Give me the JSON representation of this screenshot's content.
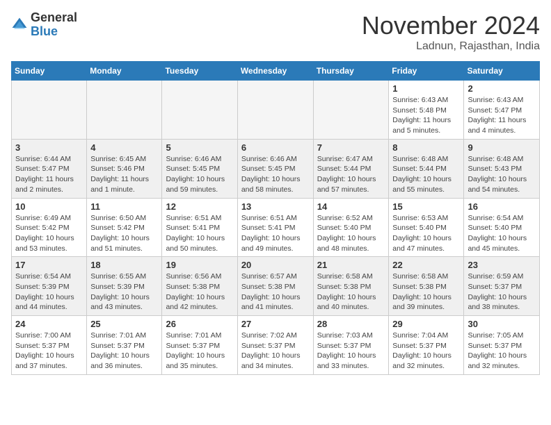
{
  "header": {
    "logo_line1": "General",
    "logo_line2": "Blue",
    "month": "November 2024",
    "location": "Ladnun, Rajasthan, India"
  },
  "days_of_week": [
    "Sunday",
    "Monday",
    "Tuesday",
    "Wednesday",
    "Thursday",
    "Friday",
    "Saturday"
  ],
  "weeks": [
    [
      {
        "day": "",
        "empty": true
      },
      {
        "day": "",
        "empty": true
      },
      {
        "day": "",
        "empty": true
      },
      {
        "day": "",
        "empty": true
      },
      {
        "day": "",
        "empty": true
      },
      {
        "day": "1",
        "sunrise": "6:43 AM",
        "sunset": "5:48 PM",
        "daylight": "11 hours and 5 minutes."
      },
      {
        "day": "2",
        "sunrise": "6:43 AM",
        "sunset": "5:47 PM",
        "daylight": "11 hours and 4 minutes."
      }
    ],
    [
      {
        "day": "3",
        "sunrise": "6:44 AM",
        "sunset": "5:47 PM",
        "daylight": "11 hours and 2 minutes."
      },
      {
        "day": "4",
        "sunrise": "6:45 AM",
        "sunset": "5:46 PM",
        "daylight": "11 hours and 1 minute."
      },
      {
        "day": "5",
        "sunrise": "6:46 AM",
        "sunset": "5:45 PM",
        "daylight": "10 hours and 59 minutes."
      },
      {
        "day": "6",
        "sunrise": "6:46 AM",
        "sunset": "5:45 PM",
        "daylight": "10 hours and 58 minutes."
      },
      {
        "day": "7",
        "sunrise": "6:47 AM",
        "sunset": "5:44 PM",
        "daylight": "10 hours and 57 minutes."
      },
      {
        "day": "8",
        "sunrise": "6:48 AM",
        "sunset": "5:44 PM",
        "daylight": "10 hours and 55 minutes."
      },
      {
        "day": "9",
        "sunrise": "6:48 AM",
        "sunset": "5:43 PM",
        "daylight": "10 hours and 54 minutes."
      }
    ],
    [
      {
        "day": "10",
        "sunrise": "6:49 AM",
        "sunset": "5:42 PM",
        "daylight": "10 hours and 53 minutes."
      },
      {
        "day": "11",
        "sunrise": "6:50 AM",
        "sunset": "5:42 PM",
        "daylight": "10 hours and 51 minutes."
      },
      {
        "day": "12",
        "sunrise": "6:51 AM",
        "sunset": "5:41 PM",
        "daylight": "10 hours and 50 minutes."
      },
      {
        "day": "13",
        "sunrise": "6:51 AM",
        "sunset": "5:41 PM",
        "daylight": "10 hours and 49 minutes."
      },
      {
        "day": "14",
        "sunrise": "6:52 AM",
        "sunset": "5:40 PM",
        "daylight": "10 hours and 48 minutes."
      },
      {
        "day": "15",
        "sunrise": "6:53 AM",
        "sunset": "5:40 PM",
        "daylight": "10 hours and 47 minutes."
      },
      {
        "day": "16",
        "sunrise": "6:54 AM",
        "sunset": "5:40 PM",
        "daylight": "10 hours and 45 minutes."
      }
    ],
    [
      {
        "day": "17",
        "sunrise": "6:54 AM",
        "sunset": "5:39 PM",
        "daylight": "10 hours and 44 minutes."
      },
      {
        "day": "18",
        "sunrise": "6:55 AM",
        "sunset": "5:39 PM",
        "daylight": "10 hours and 43 minutes."
      },
      {
        "day": "19",
        "sunrise": "6:56 AM",
        "sunset": "5:38 PM",
        "daylight": "10 hours and 42 minutes."
      },
      {
        "day": "20",
        "sunrise": "6:57 AM",
        "sunset": "5:38 PM",
        "daylight": "10 hours and 41 minutes."
      },
      {
        "day": "21",
        "sunrise": "6:58 AM",
        "sunset": "5:38 PM",
        "daylight": "10 hours and 40 minutes."
      },
      {
        "day": "22",
        "sunrise": "6:58 AM",
        "sunset": "5:38 PM",
        "daylight": "10 hours and 39 minutes."
      },
      {
        "day": "23",
        "sunrise": "6:59 AM",
        "sunset": "5:37 PM",
        "daylight": "10 hours and 38 minutes."
      }
    ],
    [
      {
        "day": "24",
        "sunrise": "7:00 AM",
        "sunset": "5:37 PM",
        "daylight": "10 hours and 37 minutes."
      },
      {
        "day": "25",
        "sunrise": "7:01 AM",
        "sunset": "5:37 PM",
        "daylight": "10 hours and 36 minutes."
      },
      {
        "day": "26",
        "sunrise": "7:01 AM",
        "sunset": "5:37 PM",
        "daylight": "10 hours and 35 minutes."
      },
      {
        "day": "27",
        "sunrise": "7:02 AM",
        "sunset": "5:37 PM",
        "daylight": "10 hours and 34 minutes."
      },
      {
        "day": "28",
        "sunrise": "7:03 AM",
        "sunset": "5:37 PM",
        "daylight": "10 hours and 33 minutes."
      },
      {
        "day": "29",
        "sunrise": "7:04 AM",
        "sunset": "5:37 PM",
        "daylight": "10 hours and 32 minutes."
      },
      {
        "day": "30",
        "sunrise": "7:05 AM",
        "sunset": "5:37 PM",
        "daylight": "10 hours and 32 minutes."
      }
    ]
  ]
}
